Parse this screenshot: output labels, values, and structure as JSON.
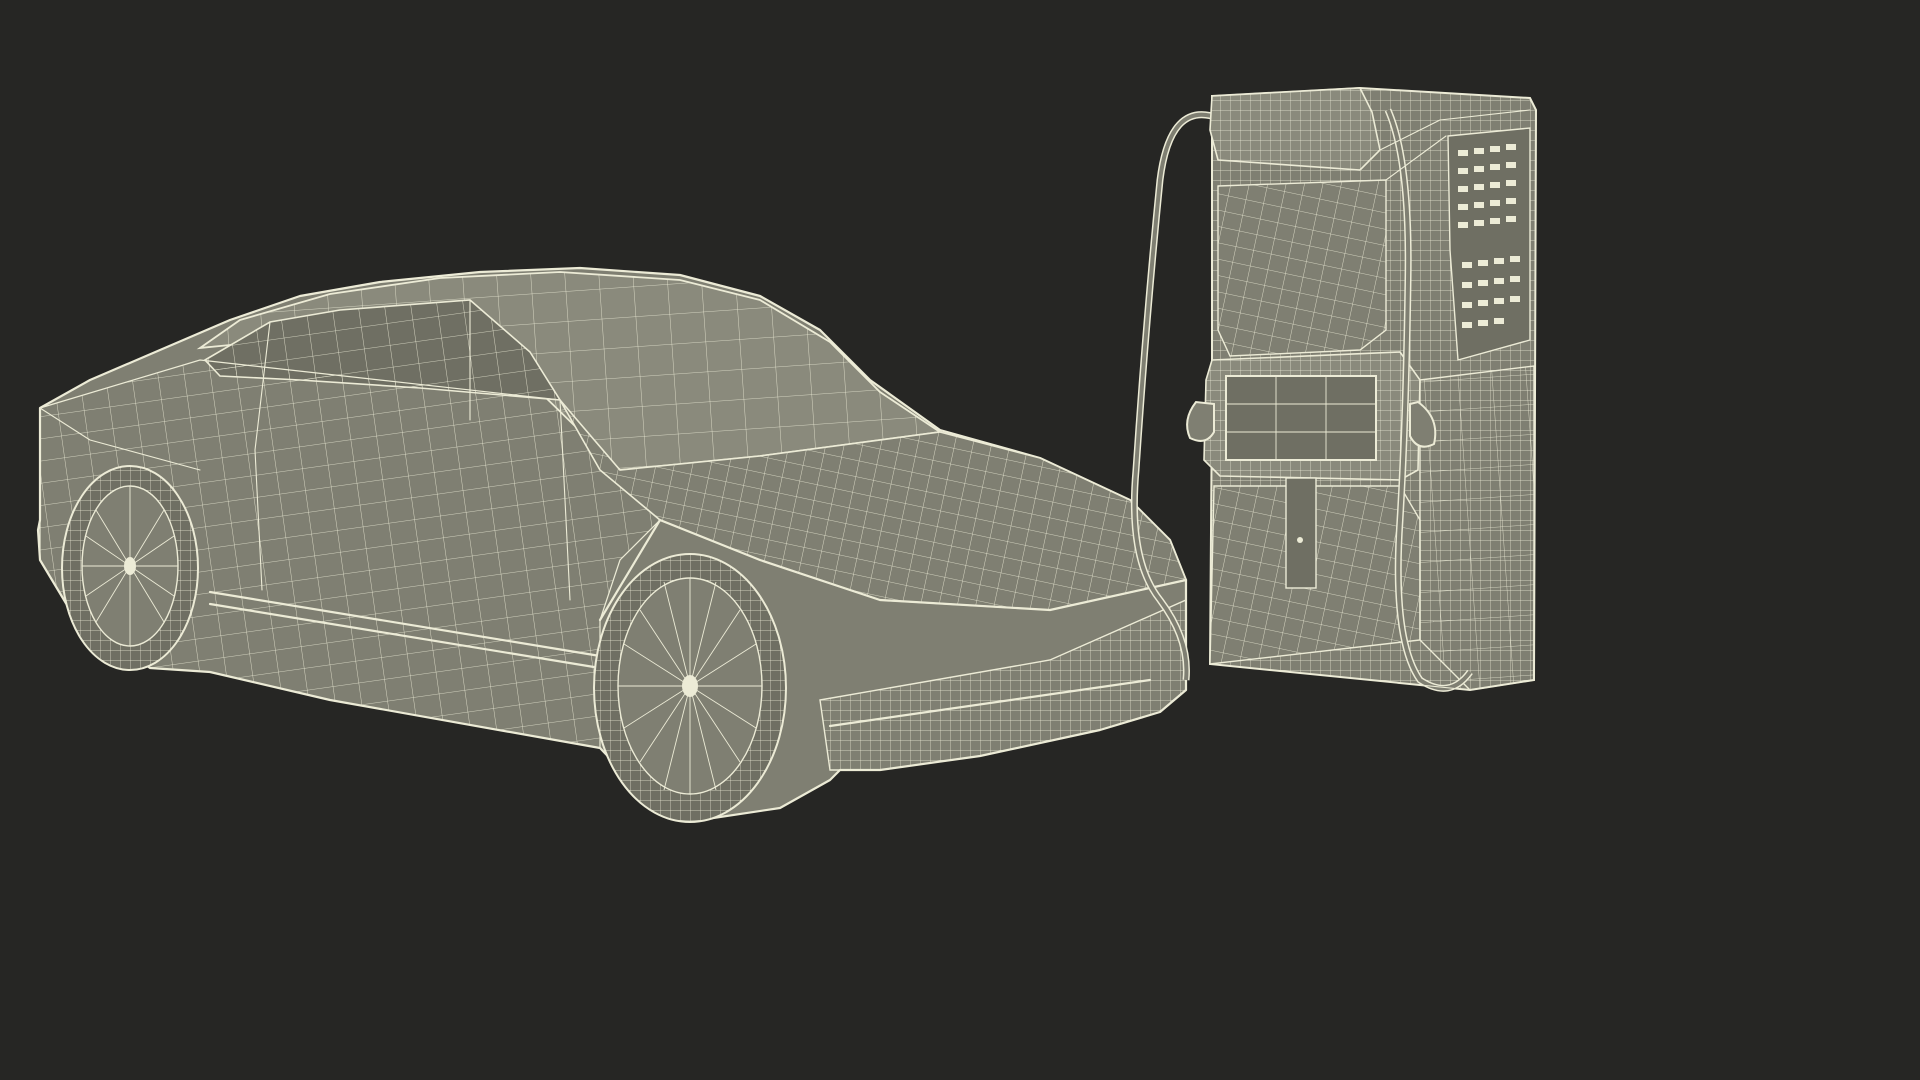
{
  "scene": {
    "background_color": "#262624",
    "wire_color": "#ecebd6",
    "surface_color": "#7f7f72",
    "objects": [
      {
        "name": "electric-car",
        "render_style": "wireframe"
      },
      {
        "name": "charging-station",
        "render_style": "wireframe"
      }
    ]
  }
}
